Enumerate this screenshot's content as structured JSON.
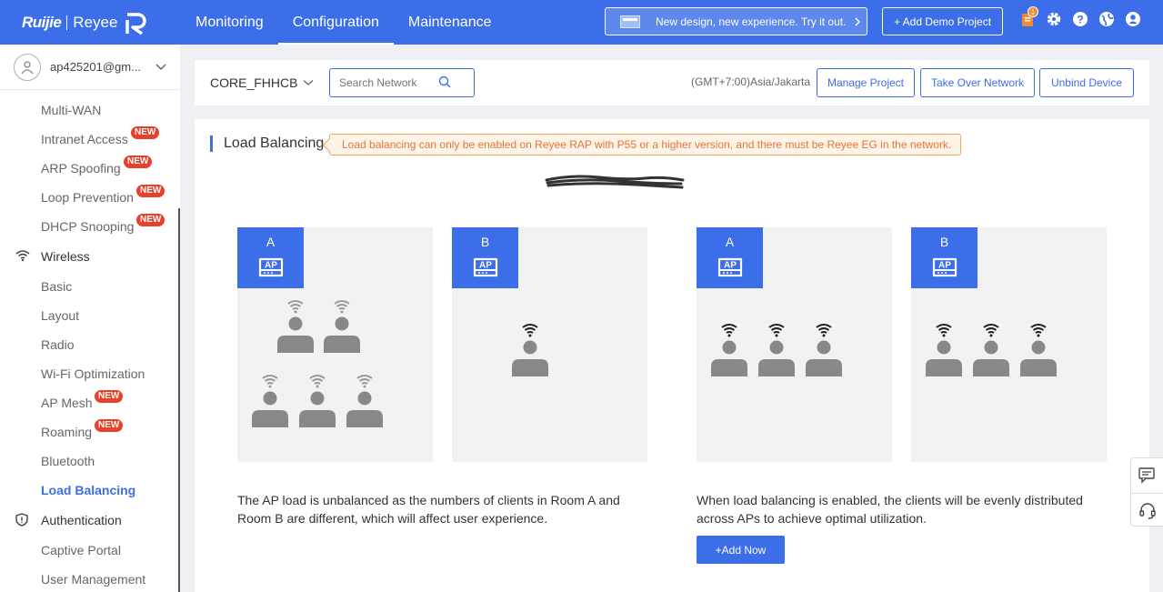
{
  "header": {
    "brand": "Ruijie",
    "brand_sub": "Reyee",
    "nav": [
      {
        "label": "Monitoring"
      },
      {
        "label": "Configuration"
      },
      {
        "label": "Maintenance"
      }
    ],
    "promo_text": "New design, new experience. Try it out.",
    "demo_button": "+ Add Demo Project",
    "notification_count": "1",
    "colors": {
      "primary": "#3b6ee8",
      "badge": "#e8412b",
      "notice": "#e8743b"
    }
  },
  "sidebar": {
    "user": "ap425201@gm...",
    "new_label": "NEW",
    "items": [
      {
        "label": "Multi-WAN"
      },
      {
        "label": "Intranet Access"
      },
      {
        "label": "ARP Spoofing"
      },
      {
        "label": "Loop Prevention"
      },
      {
        "label": "DHCP Snooping"
      },
      {
        "label": "Wireless"
      },
      {
        "label": "Basic"
      },
      {
        "label": "Layout"
      },
      {
        "label": "Radio"
      },
      {
        "label": "Wi-Fi Optimization"
      },
      {
        "label": "AP Mesh"
      },
      {
        "label": "Roaming"
      },
      {
        "label": "Bluetooth"
      },
      {
        "label": "Load Balancing"
      },
      {
        "label": "Authentication"
      },
      {
        "label": "Captive Portal"
      },
      {
        "label": "User Management"
      }
    ]
  },
  "project": {
    "name": "CORE_FHHCB",
    "search_placeholder": "Search Network",
    "timezone": "(GMT+7:00)Asia/Jakarta",
    "buttons": {
      "manage": "Manage Project",
      "takeover": "Take Over Network",
      "unbind": "Unbind Device"
    }
  },
  "main": {
    "title": "Load Balancing",
    "notice": "Load balancing can only be enabled on Reyee RAP with P55 or a higher version, and there must be Reyee EG in the network.",
    "rooms": [
      {
        "letter": "A",
        "ap_label": "AP"
      },
      {
        "letter": "B",
        "ap_label": "AP"
      },
      {
        "letter": "A",
        "ap_label": "AP"
      },
      {
        "letter": "B",
        "ap_label": "AP"
      }
    ],
    "desc_unbalanced": "The AP load is unbalanced as the numbers of clients in Room A and Room B are different, which will affect user experience.",
    "desc_balanced": "When load balancing is enabled, the clients will be evenly distributed across APs to achieve optimal utilization.",
    "add_button": "+Add Now"
  }
}
